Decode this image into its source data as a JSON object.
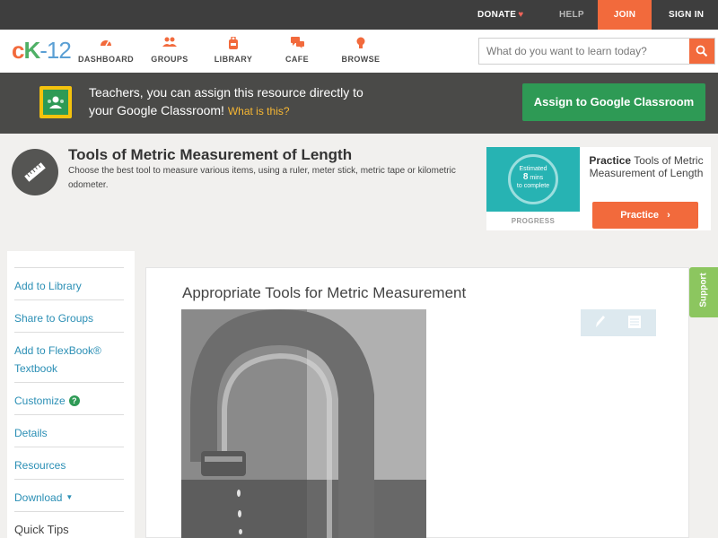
{
  "topbar": {
    "donate": "DONATE",
    "help": "HELP",
    "join": "JOIN",
    "signin": "SIGN IN"
  },
  "nav": {
    "logo_c": "c",
    "logo_k": "K",
    "logo_n": "-12",
    "items": [
      {
        "label": "DASHBOARD",
        "icon": "dashboard-gauge-icon"
      },
      {
        "label": "GROUPS",
        "icon": "groups-people-icon"
      },
      {
        "label": "LIBRARY",
        "icon": "library-backpack-icon"
      },
      {
        "label": "CAFE",
        "icon": "cafe-chat-icon"
      },
      {
        "label": "BROWSE",
        "icon": "browse-lightbulb-icon"
      }
    ],
    "search_placeholder": "What do you want to learn today?"
  },
  "classroom_banner": {
    "line1": "Teachers, you can assign this resource directly to",
    "line2": "your Google Classroom!",
    "what_link": "What is this?",
    "button": "Assign to Google Classroom"
  },
  "resource": {
    "title": "Tools of Metric Measurement of Length",
    "description": "Choose the best tool to measure various items, using a ruler, meter stick, metric tape or kilometric odometer."
  },
  "practice_card": {
    "estimated": "Estimated",
    "mins_value": "8",
    "mins": "mins",
    "to_complete": "to complete",
    "progress_label": "PROGRESS",
    "title_bold": "Practice",
    "title_rest": "Tools of Metric Measurement of Length",
    "button": "Practice"
  },
  "sidebar": {
    "items": [
      "Add to Library",
      "Share to Groups",
      "Add to FlexBook® Textbook",
      "Customize",
      "Details",
      "Resources",
      "Download"
    ],
    "quick_tips": "Quick Tips"
  },
  "content": {
    "title": "Appropriate Tools for Metric Measurement"
  },
  "support_tab": "Support",
  "colors": {
    "accent_orange": "#f26a3c",
    "google_green": "#2e9a55",
    "link_blue": "#2b8fb5",
    "support_green": "#8cc65f"
  }
}
